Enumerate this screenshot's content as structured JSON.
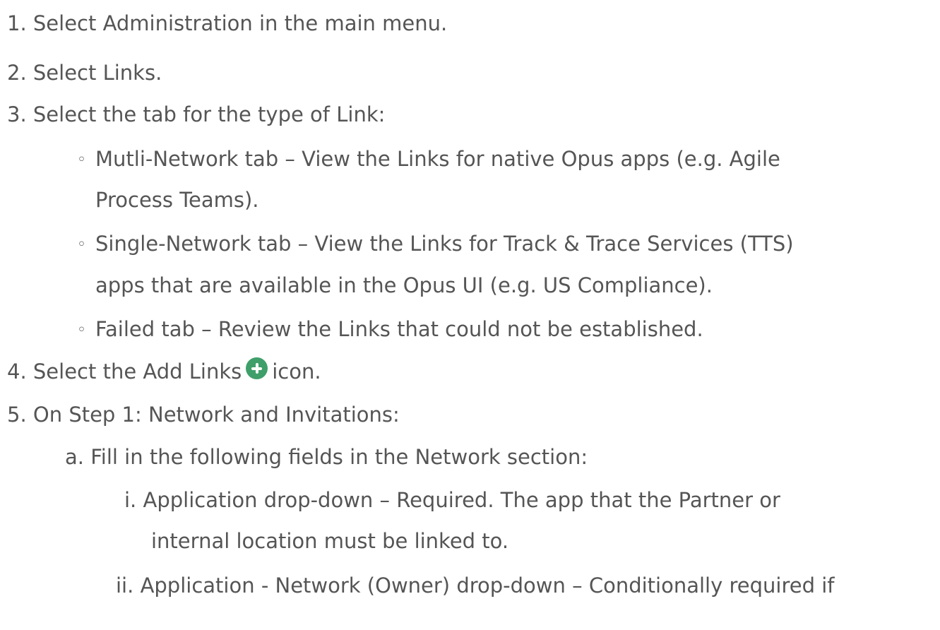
{
  "steps": [
    {
      "marker": "1.",
      "text": "Select Administration in the main menu."
    },
    {
      "marker": "2.",
      "text": "Select Links."
    },
    {
      "marker": "3.",
      "text": "Select the tab for the type of Link:"
    },
    {
      "marker": "4.",
      "text_before": "Select the Add Links",
      "text_after": "icon.",
      "icon": "add-circle-icon",
      "icon_color": "#3f9f6a"
    },
    {
      "marker": "5.",
      "text": "On Step 1: Network and Invitations:"
    }
  ],
  "tabs": [
    {
      "bullet": "◦",
      "line1": "Mutli-Network tab – View the Links for native Opus apps (e.g. Agile",
      "line2": "Process Teams)."
    },
    {
      "bullet": "◦",
      "line1": "Single-Network tab – View the Links for Track & Trace Services (TTS)",
      "line2": "apps that are available in the Opus UI (e.g. US Compliance)."
    },
    {
      "bullet": "◦",
      "line1": "Failed tab – Review the Links that could not be established."
    }
  ],
  "substep_a": {
    "marker": "a.",
    "text": "Fill in the following fields in the Network section:"
  },
  "fields": [
    {
      "marker": "i.",
      "line1": "Application drop-down – Required. The app that the Partner or",
      "line2": "internal location must be linked to."
    },
    {
      "marker": "ii.",
      "line1": "Application - Network (Owner) drop-down – Conditionally required if"
    }
  ]
}
